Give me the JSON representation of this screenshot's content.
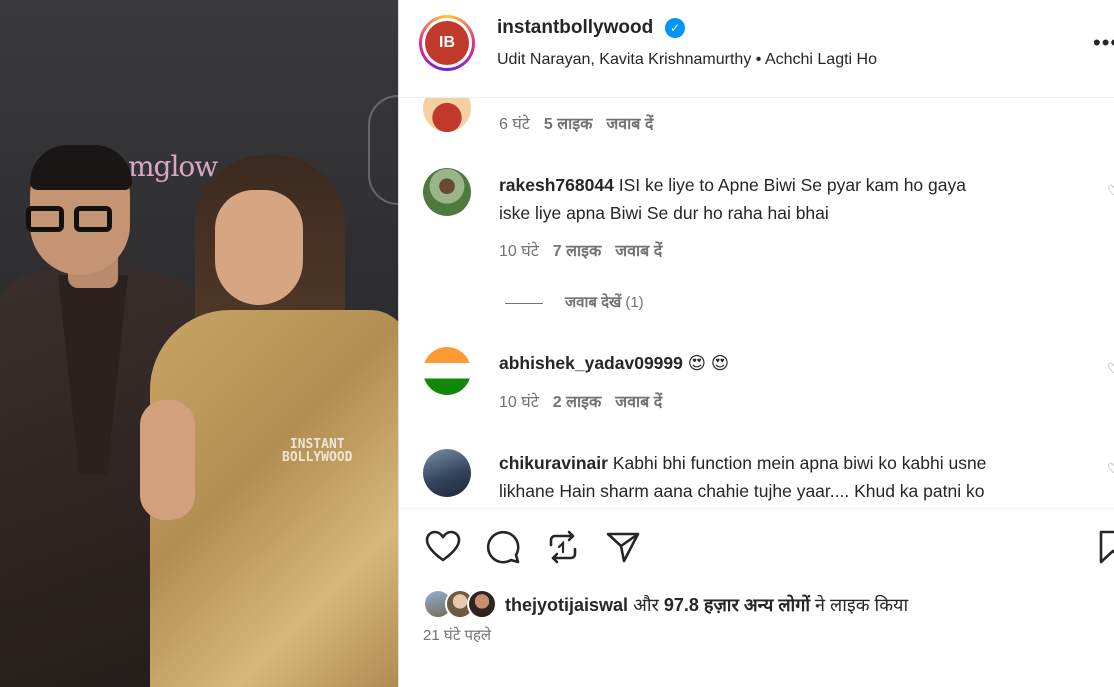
{
  "post": {
    "username": "instantbollywood",
    "avatar_text": "IB",
    "audio": "Udit Narayan, Kavita Krishnamurthy • Achchi Lagti Ho",
    "more_label": "•••"
  },
  "media": {
    "brand_text": "mglow",
    "watermark_line1": "INSTANT",
    "watermark_line2": "BOLLYWOOD"
  },
  "comments": [
    {
      "time": "6 घंटे",
      "likes": "5 लाइक",
      "reply": "जवाब दें"
    },
    {
      "username": "rakesh768044",
      "text_line1": "ISI ke liye to Apne Biwi Se pyar kam ho gaya",
      "text_line2": "iske liye apna Biwi Se dur ho raha hai bhai",
      "time": "10 घंटे",
      "likes": "7 लाइक",
      "reply": "जवाब दें"
    },
    {
      "username": "abhishek_yadav09999",
      "text_line1": "😍 😍",
      "time": "10 घंटे",
      "likes": "2 लाइक",
      "reply": "जवाब दें"
    },
    {
      "username": "chikuravinair",
      "text_line1": "Kabhi bhi function mein apna biwi ko kabhi usne",
      "text_line2": "likhane Hain sharm aana chahie tujhe yaar.... Khud ka patni ko"
    }
  ],
  "view_replies": {
    "label": "जवाब देखें",
    "count": "(1)"
  },
  "likes_summary": {
    "user": "thejyotijaiswal",
    "joiner": "और",
    "count": "97.8 हज़ार अन्य लोगों",
    "suffix": "ने लाइक किया"
  },
  "timestamp": "21 घंटे पहले",
  "colors": {
    "accent": "#0095f6",
    "text": "#262626",
    "muted": "#737373"
  }
}
